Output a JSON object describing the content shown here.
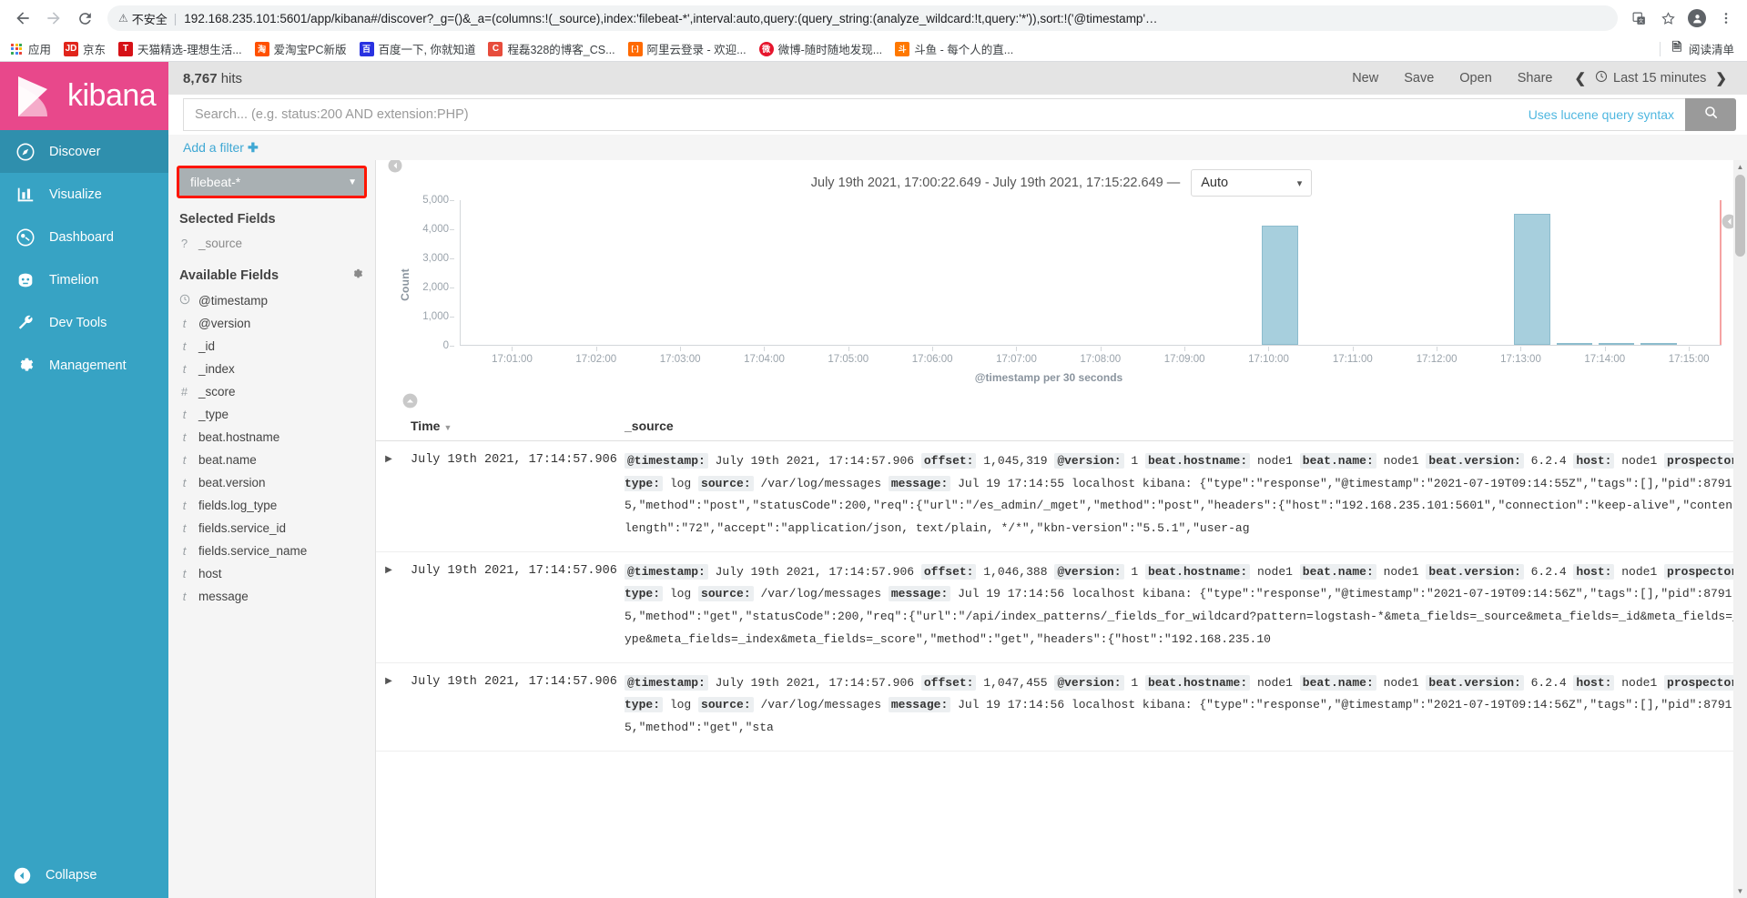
{
  "browser": {
    "back_icon": "back-arrow",
    "forward_icon": "forward-arrow",
    "reload_icon": "reload",
    "security_label": "不安全",
    "url": "192.168.235.101:5601/app/kibana#/discover?_g=()&_a=(columns:!(_source),index:'filebeat-*',interval:auto,query:(query_string:(analyze_wildcard:!t,query:'*')),sort:!('@timestamp'…",
    "translate_icon": "translate-icon",
    "bookmark_star_icon": "star-icon",
    "profile_icon": "profile-icon",
    "menu_icon": "kebab-menu-icon",
    "bookmarks": [
      {
        "label": "应用",
        "icon": "apps-grid",
        "color": "#4285f4"
      },
      {
        "label": "京东",
        "icon": "JD",
        "color": "#e1251b"
      },
      {
        "label": "天猫精选-理想生活...",
        "icon": "T",
        "color": "#d61117"
      },
      {
        "label": "爱淘宝PC新版",
        "icon": "淘",
        "color": "#ff5000"
      },
      {
        "label": "百度一下, 你就知道",
        "icon": "百",
        "color": "#2932e1"
      },
      {
        "label": "程磊328的博客_CS...",
        "icon": "C",
        "color": "#e74c3c"
      },
      {
        "label": "阿里云登录 - 欢迎...",
        "icon": "[-]",
        "color": "#ff6a00"
      },
      {
        "label": "微博-随时随地发现...",
        "icon": "微",
        "color": "#e6162d"
      },
      {
        "label": "斗鱼 - 每个人的直...",
        "icon": "斗",
        "color": "#ff7800"
      }
    ],
    "reading_list": "阅读清单",
    "reading_list_icon": "reading-list-icon"
  },
  "sidebar": {
    "brand": "kibana",
    "brand_color": "#e8488b",
    "nav_color": "#37a3c4",
    "items": [
      {
        "label": "Discover",
        "icon": "compass-icon",
        "active": true
      },
      {
        "label": "Visualize",
        "icon": "bar-chart-icon",
        "active": false
      },
      {
        "label": "Dashboard",
        "icon": "dashboard-icon",
        "active": false
      },
      {
        "label": "Timelion",
        "icon": "timelion-icon",
        "active": false
      },
      {
        "label": "Dev Tools",
        "icon": "wrench-icon",
        "active": false
      },
      {
        "label": "Management",
        "icon": "gear-icon",
        "active": false
      }
    ],
    "collapse_label": "Collapse",
    "collapse_icon": "chevron-left-circle-icon"
  },
  "topbar": {
    "hits_count": "8,767",
    "hits_label": "hits",
    "new_label": "New",
    "save_label": "Save",
    "open_label": "Open",
    "share_label": "Share",
    "time_prev_icon": "chevron-left-icon",
    "time_next_icon": "chevron-right-icon",
    "time_clock_icon": "clock-icon",
    "time_range_label": "Last 15 minutes"
  },
  "search": {
    "placeholder": "Search... (e.g. status:200 AND extension:PHP)",
    "value": "",
    "lucene_hint": "Uses lucene query syntax",
    "search_icon": "magnifier-icon"
  },
  "filters": {
    "add_filter_label": "Add a filter",
    "plus_icon": "plus-icon"
  },
  "fields": {
    "index_pattern": "filebeat-*",
    "index_caret_icon": "caret-down-icon",
    "highlight_color": "#ff1500",
    "selected_title": "Selected Fields",
    "selected": [
      {
        "name": "_source",
        "type": "?"
      }
    ],
    "available_title": "Available Fields",
    "settings_icon": "gear-icon",
    "available": [
      {
        "name": "@timestamp",
        "type": "clock"
      },
      {
        "name": "@version",
        "type": "t"
      },
      {
        "name": "_id",
        "type": "t"
      },
      {
        "name": "_index",
        "type": "t"
      },
      {
        "name": "_score",
        "type": "#"
      },
      {
        "name": "_type",
        "type": "t"
      },
      {
        "name": "beat.hostname",
        "type": "t"
      },
      {
        "name": "beat.name",
        "type": "t"
      },
      {
        "name": "beat.version",
        "type": "t"
      },
      {
        "name": "fields.log_type",
        "type": "t"
      },
      {
        "name": "fields.service_id",
        "type": "t"
      },
      {
        "name": "fields.service_name",
        "type": "t"
      },
      {
        "name": "host",
        "type": "t"
      },
      {
        "name": "message",
        "type": "t"
      }
    ]
  },
  "chart_header": {
    "range_text": "July 19th 2021, 17:00:22.649 - July 19th 2021, 17:15:22.649 —",
    "interval_value": "Auto",
    "interval_caret_icon": "caret-down-icon",
    "collapse_icon": "chevron-up-circle-icon"
  },
  "chart_data": {
    "type": "bar",
    "title": "",
    "xlabel": "@timestamp per 30 seconds",
    "ylabel": "Count",
    "ylim": [
      0,
      5000
    ],
    "yticks": [
      0,
      1000,
      2000,
      3000,
      4000,
      5000
    ],
    "ytick_labels": [
      "0",
      "1,000",
      "2,000",
      "3,000",
      "4,000",
      "5,000"
    ],
    "xtick_labels": [
      "17:01:00",
      "17:02:00",
      "17:03:00",
      "17:04:00",
      "17:05:00",
      "17:06:00",
      "17:07:00",
      "17:08:00",
      "17:09:00",
      "17:10:00",
      "17:11:00",
      "17:12:00",
      "17:13:00",
      "17:14:00",
      "17:15:00"
    ],
    "x_start": "17:00:22.649",
    "x_end": "17:15:22.649",
    "bar_color": "#a7cfdd",
    "bar_border_color": "#8cbccd",
    "now_line_color": "#f5a3a3",
    "grid": false,
    "legend": "none",
    "categories": [
      "17:00:30",
      "17:01:00",
      "17:01:30",
      "17:02:00",
      "17:02:30",
      "17:03:00",
      "17:03:30",
      "17:04:00",
      "17:04:30",
      "17:05:00",
      "17:05:30",
      "17:06:00",
      "17:06:30",
      "17:07:00",
      "17:07:30",
      "17:08:00",
      "17:08:30",
      "17:09:00",
      "17:09:30",
      "17:10:00",
      "17:10:30",
      "17:11:00",
      "17:11:30",
      "17:12:00",
      "17:12:30",
      "17:13:00",
      "17:13:30",
      "17:14:00",
      "17:14:30",
      "17:15:00"
    ],
    "values": [
      0,
      0,
      0,
      0,
      0,
      0,
      0,
      0,
      0,
      0,
      0,
      0,
      0,
      0,
      0,
      0,
      0,
      0,
      0,
      4100,
      0,
      0,
      0,
      0,
      0,
      4500,
      60,
      55,
      45,
      0
    ]
  },
  "doc_table": {
    "collapse_icon": "chevron-up-circle-icon",
    "columns": [
      {
        "key": "expand",
        "label": ""
      },
      {
        "key": "time",
        "label": "Time",
        "sorted": true,
        "sort_icon": "caret-down-icon"
      },
      {
        "key": "_source",
        "label": "_source"
      }
    ],
    "rows": [
      {
        "expand_icon": "triangle-right-icon",
        "time": "July 19th 2021, 17:14:57.906",
        "source_pairs": [
          {
            "k": "@timestamp:",
            "v": "July 19th 2021, 17:14:57.906"
          },
          {
            "k": "offset:",
            "v": "1,045,319"
          },
          {
            "k": "@version:",
            "v": "1"
          },
          {
            "k": "beat.hostname:",
            "v": "node1"
          },
          {
            "k": "beat.name:",
            "v": "node1"
          },
          {
            "k": "beat.version:",
            "v": "6.2.4"
          },
          {
            "k": "host:",
            "v": "node1"
          },
          {
            "k": "prospector.type:",
            "v": "log"
          },
          {
            "k": "source:",
            "v": "/var/log/messages"
          },
          {
            "k": "message:",
            "v": "Jul 19 17:14:55 localhost kibana: {\"type\":\"response\",\"@timestamp\":\"2021-07-19T09:14:55Z\",\"tags\":[],\"pid\":87915,\"method\":\"post\",\"statusCode\":200,\"req\":{\"url\":\"/es_admin/_mget\",\"method\":\"post\",\"headers\":{\"host\":\"192.168.235.101:5601\",\"connection\":\"keep-alive\",\"content-length\":\"72\",\"accept\":\"application/json, text/plain, */*\",\"kbn-version\":\"5.5.1\",\"user-ag"
          }
        ]
      },
      {
        "expand_icon": "triangle-right-icon",
        "time": "July 19th 2021, 17:14:57.906",
        "source_pairs": [
          {
            "k": "@timestamp:",
            "v": "July 19th 2021, 17:14:57.906"
          },
          {
            "k": "offset:",
            "v": "1,046,388"
          },
          {
            "k": "@version:",
            "v": "1"
          },
          {
            "k": "beat.hostname:",
            "v": "node1"
          },
          {
            "k": "beat.name:",
            "v": "node1"
          },
          {
            "k": "beat.version:",
            "v": "6.2.4"
          },
          {
            "k": "host:",
            "v": "node1"
          },
          {
            "k": "prospector.type:",
            "v": "log"
          },
          {
            "k": "source:",
            "v": "/var/log/messages"
          },
          {
            "k": "message:",
            "v": "Jul 19 17:14:56 localhost kibana: {\"type\":\"response\",\"@timestamp\":\"2021-07-19T09:14:56Z\",\"tags\":[],\"pid\":87915,\"method\":\"get\",\"statusCode\":200,\"req\":{\"url\":\"/api/index_patterns/_fields_for_wildcard?pattern=logstash-*&meta_fields=_source&meta_fields=_id&meta_fields=_type&meta_fields=_index&meta_fields=_score\",\"method\":\"get\",\"headers\":{\"host\":\"192.168.235.10"
          }
        ]
      },
      {
        "expand_icon": "triangle-right-icon",
        "time": "July 19th 2021, 17:14:57.906",
        "source_pairs": [
          {
            "k": "@timestamp:",
            "v": "July 19th 2021, 17:14:57.906"
          },
          {
            "k": "offset:",
            "v": "1,047,455"
          },
          {
            "k": "@version:",
            "v": "1"
          },
          {
            "k": "beat.hostname:",
            "v": "node1"
          },
          {
            "k": "beat.name:",
            "v": "node1"
          },
          {
            "k": "beat.version:",
            "v": "6.2.4"
          },
          {
            "k": "host:",
            "v": "node1"
          },
          {
            "k": "prospector.type:",
            "v": "log"
          },
          {
            "k": "source:",
            "v": "/var/log/messages"
          },
          {
            "k": "message:",
            "v": "Jul 19 17:14:56 localhost kibana: {\"type\":\"response\",\"@timestamp\":\"2021-07-19T09:14:56Z\",\"tags\":[],\"pid\":87915,\"method\":\"get\",\"sta"
          }
        ]
      }
    ]
  }
}
